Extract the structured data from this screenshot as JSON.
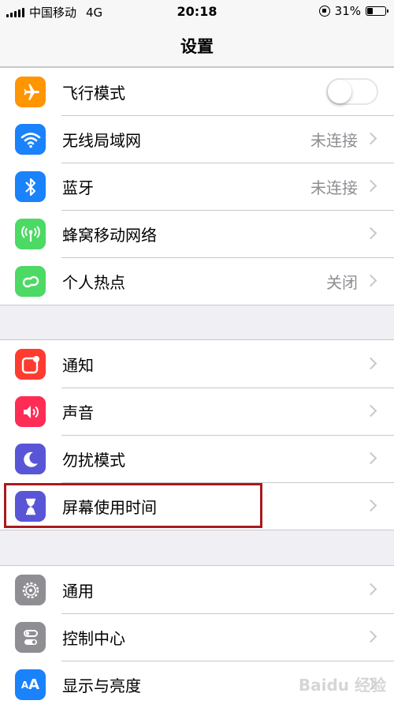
{
  "status_bar": {
    "carrier": "中国移动",
    "network": "4G",
    "time": "20:18",
    "battery_percent": "31%",
    "battery_level": 0.31
  },
  "nav": {
    "title": "设置"
  },
  "colors": {
    "airplane": "#ff9500",
    "wifi": "#1a82fb",
    "bluetooth": "#1a82fb",
    "cellular": "#4cd964",
    "hotspot": "#4cd964",
    "notifications": "#ff3b30",
    "sounds": "#ff2d55",
    "dnd": "#5856d6",
    "screentime": "#5856d6",
    "general": "#8e8e93",
    "control": "#8e8e93",
    "display": "#1a82fb",
    "highlight": "#a81a1d"
  },
  "groups": [
    {
      "items": [
        {
          "label": "飞行模式",
          "icon": "airplane-icon",
          "toggle": false
        },
        {
          "label": "无线局域网",
          "icon": "wifi-icon",
          "value": "未连接"
        },
        {
          "label": "蓝牙",
          "icon": "bluetooth-icon",
          "value": "未连接"
        },
        {
          "label": "蜂窝移动网络",
          "icon": "cellular-icon"
        },
        {
          "label": "个人热点",
          "icon": "hotspot-icon",
          "value": "关闭"
        }
      ]
    },
    {
      "items": [
        {
          "label": "通知",
          "icon": "notifications-icon"
        },
        {
          "label": "声音",
          "icon": "sounds-icon"
        },
        {
          "label": "勿扰模式",
          "icon": "moon-icon"
        },
        {
          "label": "屏幕使用时间",
          "icon": "hourglass-icon"
        }
      ]
    },
    {
      "items": [
        {
          "label": "通用",
          "icon": "gear-icon"
        },
        {
          "label": "控制中心",
          "icon": "control-center-icon"
        },
        {
          "label": "显示与亮度",
          "icon": "display-brightness-icon"
        }
      ]
    }
  ],
  "watermark": "Baidu 经验"
}
